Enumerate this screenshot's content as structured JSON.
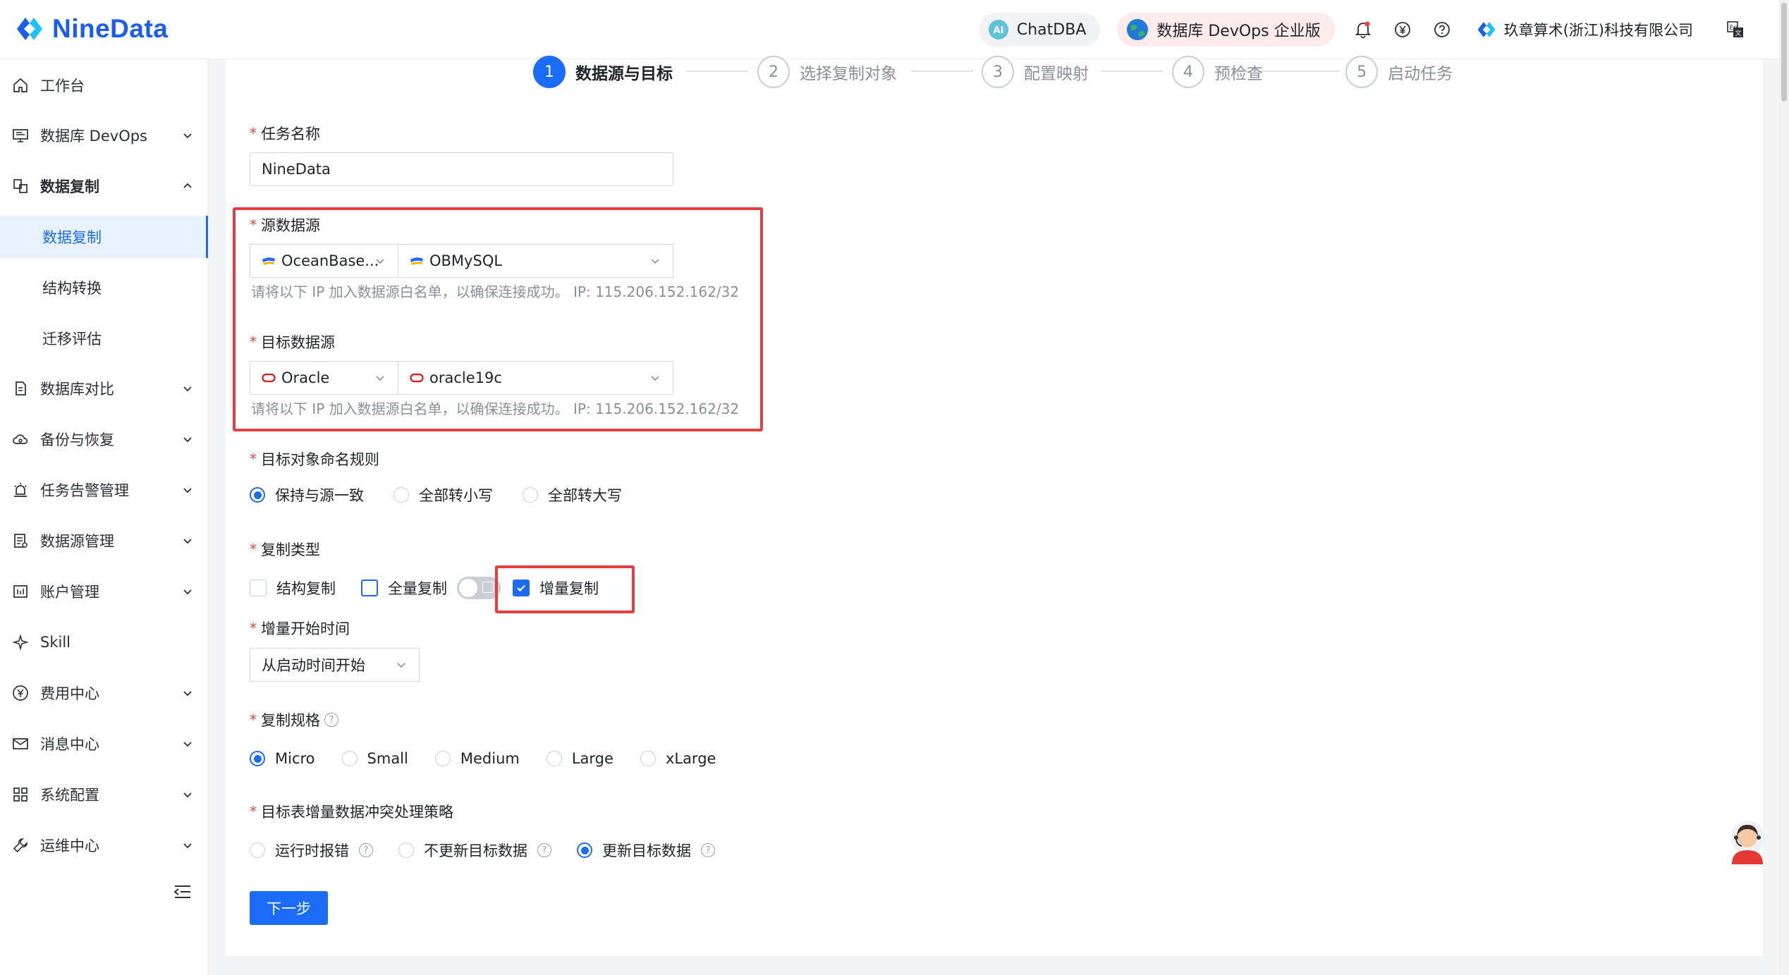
{
  "app": {
    "brand": "NineData"
  },
  "header": {
    "chat_label": "ChatDBA",
    "devops_label": "数据库 DevOps 企业版",
    "company": "玖章算术(浙江)科技有限公司"
  },
  "sidebar": {
    "items": [
      {
        "label": "工作台",
        "icon": "home-icon"
      },
      {
        "label": "数据库 DevOps",
        "icon": "monitor-icon"
      },
      {
        "label": "数据复制",
        "icon": "replication-icon"
      },
      {
        "label": "数据复制"
      },
      {
        "label": "结构转换"
      },
      {
        "label": "迁移评估"
      },
      {
        "label": "数据库对比",
        "icon": "compare-icon"
      },
      {
        "label": "备份与恢复",
        "icon": "cloud-icon"
      },
      {
        "label": "任务告警管理",
        "icon": "alarm-icon"
      },
      {
        "label": "数据源管理",
        "icon": "datasource-icon"
      },
      {
        "label": "账户管理",
        "icon": "account-icon"
      },
      {
        "label": "Skill",
        "icon": "skill-icon"
      },
      {
        "label": "费用中心",
        "icon": "yen-icon"
      },
      {
        "label": "消息中心",
        "icon": "mail-icon"
      },
      {
        "label": "系统配置",
        "icon": "grid-icon"
      },
      {
        "label": "运维中心",
        "icon": "wrench-icon"
      }
    ]
  },
  "steps": [
    {
      "num": "1",
      "label": "数据源与目标"
    },
    {
      "num": "2",
      "label": "选择复制对象"
    },
    {
      "num": "3",
      "label": "配置映射"
    },
    {
      "num": "4",
      "label": "预检查"
    },
    {
      "num": "5",
      "label": "启动任务"
    }
  ],
  "form": {
    "req": "*",
    "task_name": {
      "label": "任务名称",
      "value": "NineData"
    },
    "source": {
      "label": "源数据源",
      "type": "OceanBase...",
      "instance": "OBMySQL",
      "hint": "请将以下 IP 加入数据源白名单，以确保连接成功。 IP: 115.206.152.162/32"
    },
    "target": {
      "label": "目标数据源",
      "type": "Oracle",
      "instance": "oracle19c",
      "hint": "请将以下 IP 加入数据源白名单，以确保连接成功。 IP: 115.206.152.162/32"
    },
    "naming": {
      "label": "目标对象命名规则",
      "options": [
        "保持与源一致",
        "全部转小写",
        "全部转大写"
      ],
      "selected": 0
    },
    "copy_type": {
      "label": "复制类型",
      "options": [
        "结构复制",
        "全量复制",
        "增量复制"
      ],
      "checked": [
        false,
        false,
        true
      ]
    },
    "incr_start": {
      "label": "增量开始时间",
      "value": "从启动时间开始"
    },
    "spec": {
      "label": "复制规格",
      "options": [
        "Micro",
        "Small",
        "Medium",
        "Large",
        "xLarge"
      ],
      "selected": 0
    },
    "conflict": {
      "label": "目标表增量数据冲突处理策略",
      "options": [
        "运行时报错",
        "不更新目标数据",
        "更新目标数据"
      ],
      "selected": 2
    },
    "next_button": "下一步"
  },
  "colors": {
    "primary": "#1a6cf6",
    "highlight": "#e53e3e"
  }
}
